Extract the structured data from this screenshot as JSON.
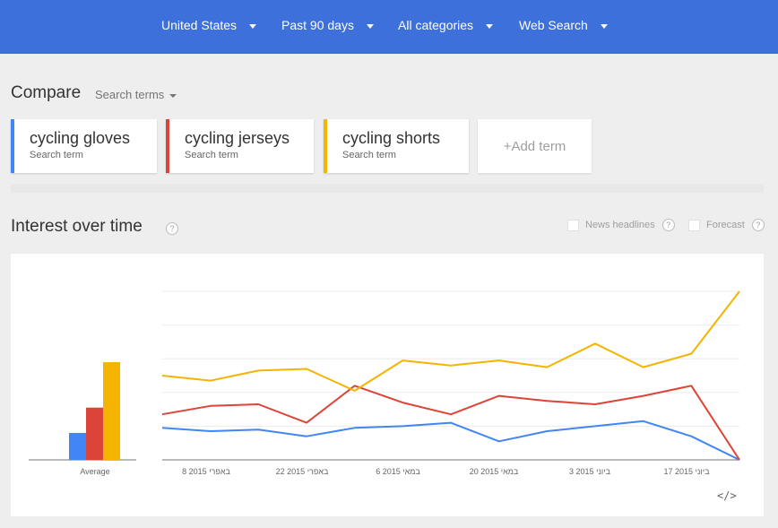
{
  "header": {
    "filters": [
      {
        "label": "United States"
      },
      {
        "label": "Past 90 days"
      },
      {
        "label": "All categories"
      },
      {
        "label": "Web Search"
      }
    ]
  },
  "compare": {
    "title": "Compare",
    "search_terms_label": "Search terms",
    "terms": [
      {
        "name": "cycling gloves",
        "sub": "Search term",
        "color": "#4285f4"
      },
      {
        "name": "cycling jerseys",
        "sub": "Search term",
        "color": "#db4437"
      },
      {
        "name": "cycling shorts",
        "sub": "Search term",
        "color": "#f4b400"
      }
    ],
    "add_term_label": "+Add term"
  },
  "interest": {
    "title": "Interest over time",
    "help": "?",
    "news_label": "News headlines",
    "forecast_label": "Forecast",
    "embed_label": "</>"
  },
  "chart_data": {
    "type": "line",
    "ylim": [
      0,
      100
    ],
    "grid": true,
    "x": [
      "8 באפרי 2015",
      "22 באפרי 2015",
      "6 במאי 2015",
      "20 במאי 2015",
      "3 ביוני 2015",
      "17 ביוני 2015"
    ],
    "series": [
      {
        "name": "cycling gloves",
        "color": "#4285f4",
        "average": 16,
        "values": [
          19,
          17,
          18,
          14,
          19,
          20,
          22,
          11,
          17,
          20,
          23,
          14,
          0
        ]
      },
      {
        "name": "cycling jerseys",
        "color": "#db4437",
        "average": 31,
        "values": [
          27,
          32,
          33,
          22,
          44,
          34,
          27,
          38,
          35,
          33,
          38,
          44,
          0
        ]
      },
      {
        "name": "cycling shorts",
        "color": "#f4b400",
        "average": 58,
        "values": [
          50,
          47,
          53,
          54,
          41,
          59,
          56,
          59,
          55,
          69,
          55,
          63,
          100
        ]
      }
    ],
    "average_label": "Average"
  }
}
